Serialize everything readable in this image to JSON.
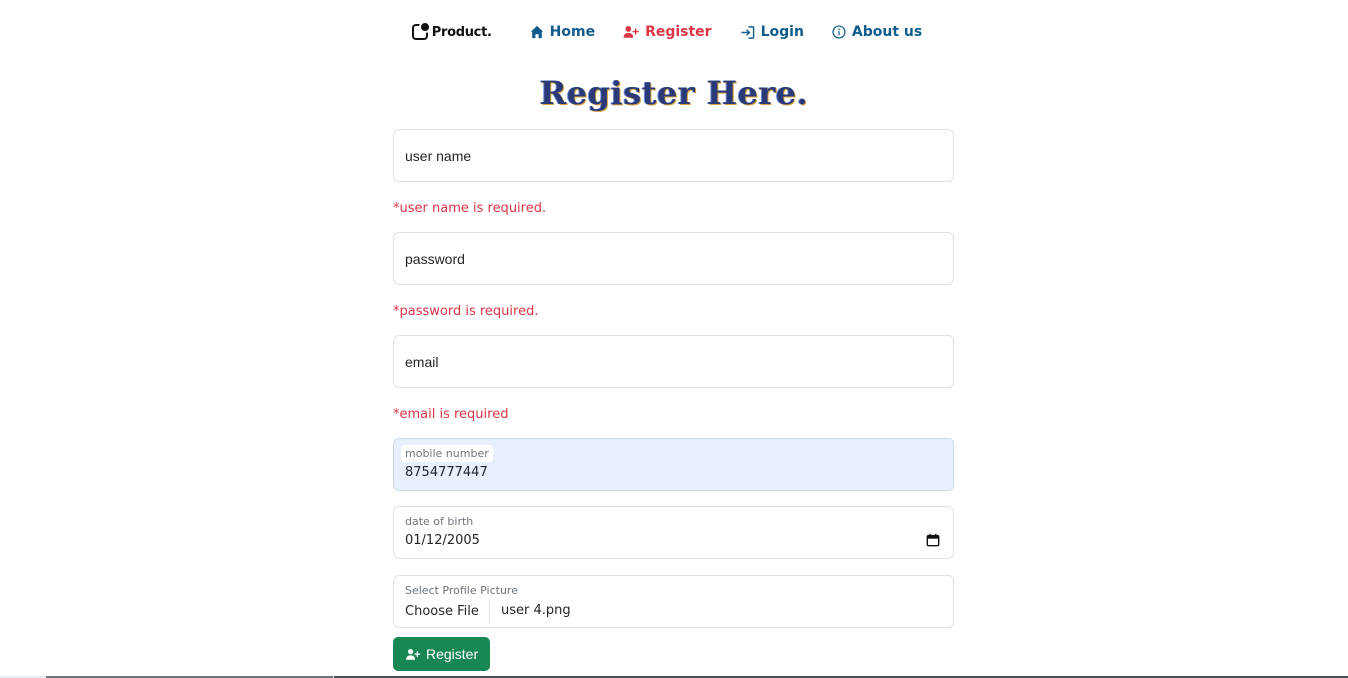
{
  "nav": {
    "brand": "Product.",
    "items": [
      {
        "label": "Home",
        "icon": "home-icon",
        "active": false
      },
      {
        "label": "Register",
        "icon": "user-plus-icon",
        "active": true
      },
      {
        "label": "Login",
        "icon": "login-icon",
        "active": false
      },
      {
        "label": "About us",
        "icon": "info-icon",
        "active": false
      }
    ]
  },
  "title": "Register Here.",
  "form": {
    "username": {
      "placeholder": "user name",
      "value": "",
      "error": "*user name is required."
    },
    "password": {
      "placeholder": "password",
      "value": "",
      "error": "*password is required."
    },
    "email": {
      "placeholder": "email",
      "value": "",
      "error": "*email is required"
    },
    "mobile": {
      "label": "mobile number",
      "value": "8754777447"
    },
    "dob": {
      "label": "date of birth",
      "value": "01/12/2005"
    },
    "picture": {
      "label": "Select Profile Picture",
      "button": "Choose File",
      "filename": "user 4.png"
    },
    "submit": "Register"
  },
  "colors": {
    "nav_link": "#0d5c8c",
    "nav_active": "#dc3545",
    "error": "#dc3545",
    "submit_bg": "#198754",
    "autofill_bg": "#e8f0fe"
  }
}
